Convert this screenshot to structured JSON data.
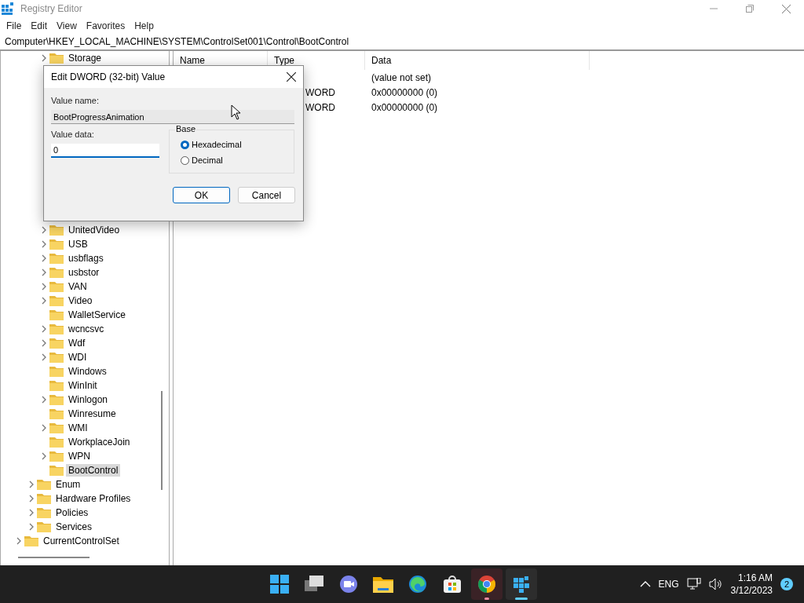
{
  "window": {
    "title": "Registry Editor"
  },
  "menu": [
    "File",
    "Edit",
    "View",
    "Favorites",
    "Help"
  ],
  "address": "Computer\\HKEY_LOCAL_MACHINE\\SYSTEM\\ControlSet001\\Control\\BootControl",
  "tree": [
    {
      "children": [
        {
          "children": [
            {
              "label": "Storage",
              "expandable": true,
              "selected": false
            },
            {
              "label": "UnitedVideo",
              "expandable": true,
              "selected": false
            },
            {
              "label": "USB",
              "expandable": true,
              "selected": false
            },
            {
              "label": "usbflags",
              "expandable": true,
              "selected": false
            },
            {
              "label": "usbstor",
              "expandable": true,
              "selected": false
            },
            {
              "label": "VAN",
              "expandable": true,
              "selected": false
            },
            {
              "label": "Video",
              "expandable": true,
              "selected": false
            },
            {
              "label": "WalletService",
              "expandable": false,
              "selected": false
            },
            {
              "label": "wcncsvc",
              "expandable": true,
              "selected": false
            },
            {
              "label": "Wdf",
              "expandable": true,
              "selected": false
            },
            {
              "label": "WDI",
              "expandable": true,
              "selected": false
            },
            {
              "label": "Windows",
              "expandable": false,
              "selected": false
            },
            {
              "label": "WinInit",
              "expandable": false,
              "selected": false
            },
            {
              "label": "Winlogon",
              "expandable": true,
              "selected": false
            },
            {
              "label": "Winresume",
              "expandable": false,
              "selected": false
            },
            {
              "label": "WMI",
              "expandable": true,
              "selected": false
            },
            {
              "label": "WorkplaceJoin",
              "expandable": false,
              "selected": false
            },
            {
              "label": "WPN",
              "expandable": true,
              "selected": false
            },
            {
              "label": "BootControl",
              "expandable": false,
              "selected": true
            }
          ]
        },
        {
          "label": "Enum",
          "expandable": true,
          "selected": false
        },
        {
          "label": "Hardware Profiles",
          "expandable": true,
          "selected": false
        },
        {
          "label": "Policies",
          "expandable": true,
          "selected": false
        },
        {
          "label": "Services",
          "expandable": true,
          "selected": false
        }
      ]
    },
    {
      "label": "CurrentControlSet",
      "expandable": true,
      "selected": false
    }
  ],
  "list": {
    "columns": [
      "Name",
      "Type",
      "Data"
    ],
    "rows": [
      {
        "data": "(value not set)"
      },
      {
        "type": "WORD",
        "data": "0x00000000 (0)"
      },
      {
        "type": "WORD",
        "data": "0x00000000 (0)"
      }
    ]
  },
  "dialog": {
    "title": "Edit DWORD (32-bit) Value",
    "name_label": "Value name:",
    "name_value": "BootProgressAnimation",
    "data_label": "Value data:",
    "data_value": "0",
    "base_label": "Base",
    "radios": [
      {
        "label": "Hexadecimal",
        "selected": true
      },
      {
        "label": "Decimal",
        "selected": false
      }
    ],
    "buttons": [
      {
        "label": "OK",
        "default": true
      },
      {
        "label": "Cancel",
        "default": false
      }
    ]
  },
  "taskbar": {
    "apps": [
      {
        "kind": "start",
        "open": false,
        "focused": false
      },
      {
        "kind": "taskview",
        "open": false,
        "focused": false
      },
      {
        "kind": "chat",
        "open": false,
        "focused": false
      },
      {
        "kind": "explorer",
        "open": false,
        "focused": false
      },
      {
        "kind": "edge",
        "open": false,
        "focused": false
      },
      {
        "kind": "store",
        "open": false,
        "focused": false
      },
      {
        "kind": "chrome",
        "open": true,
        "focused": false
      },
      {
        "kind": "regedit",
        "open": true,
        "focused": true
      }
    ],
    "language": "ENG",
    "time": "1:16 AM",
    "date": "3/12/2023",
    "notifications": "2"
  }
}
